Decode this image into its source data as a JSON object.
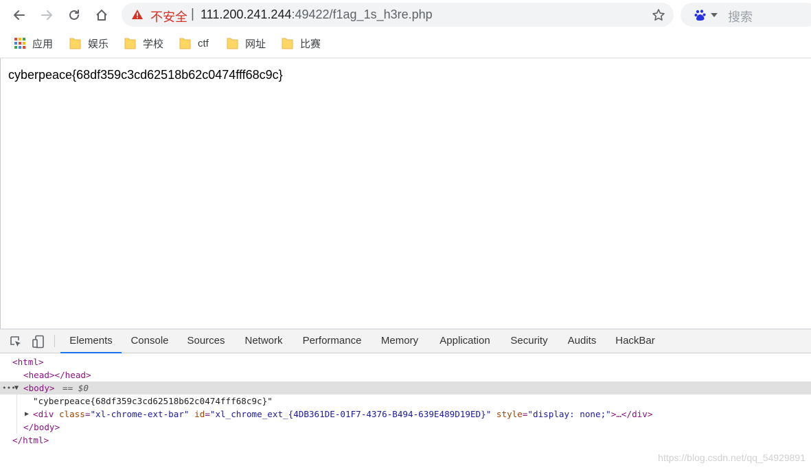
{
  "toolbar": {
    "insecure_label": "不安全",
    "separator": "|",
    "url_host": "111.200.241.244",
    "url_rest": ":49422/f1ag_1s_h3re.php",
    "search_placeholder": "搜索"
  },
  "bookmarks": {
    "apps_label": "应用",
    "items": [
      "娱乐",
      "学校",
      "ctf",
      "网址",
      "比赛"
    ]
  },
  "page": {
    "flag_text": "cyberpeace{68df359c3cd62518b62c0474fff68c9c}"
  },
  "devtools": {
    "tabs": [
      "Elements",
      "Console",
      "Sources",
      "Network",
      "Performance",
      "Memory",
      "Application",
      "Security",
      "Audits",
      "HackBar"
    ],
    "active_tab": "Elements",
    "dom": {
      "html_open": "<html>",
      "head_line": "<head></head>",
      "body_open": "<body>",
      "body_marker": "== $0",
      "text_node": "\"cyberpeace{68df359c3cd62518b62c0474fff68c9c}\"",
      "div_tag_open": "<div",
      "div_attr_class_name": "class",
      "div_attr_class_value": "\"xl-chrome-ext-bar\"",
      "div_attr_id_name": "id",
      "div_attr_id_value": "\"xl_chrome_ext_{4DB361DE-01F7-4376-B494-639E489D19ED}\"",
      "div_attr_style_name": "style",
      "div_attr_style_value": "\"display: none;\"",
      "div_tag_rest": ">…</div>",
      "body_close": "</body>",
      "html_close": "</html>"
    }
  },
  "watermark": "https://blog.csdn.net/qq_54929891",
  "colors": {
    "insecure_red": "#d93025",
    "devtools_active_tab": "#1a73e8",
    "dom_tag": "#881280",
    "dom_attr": "#994500",
    "dom_value": "#1a1aa6"
  }
}
